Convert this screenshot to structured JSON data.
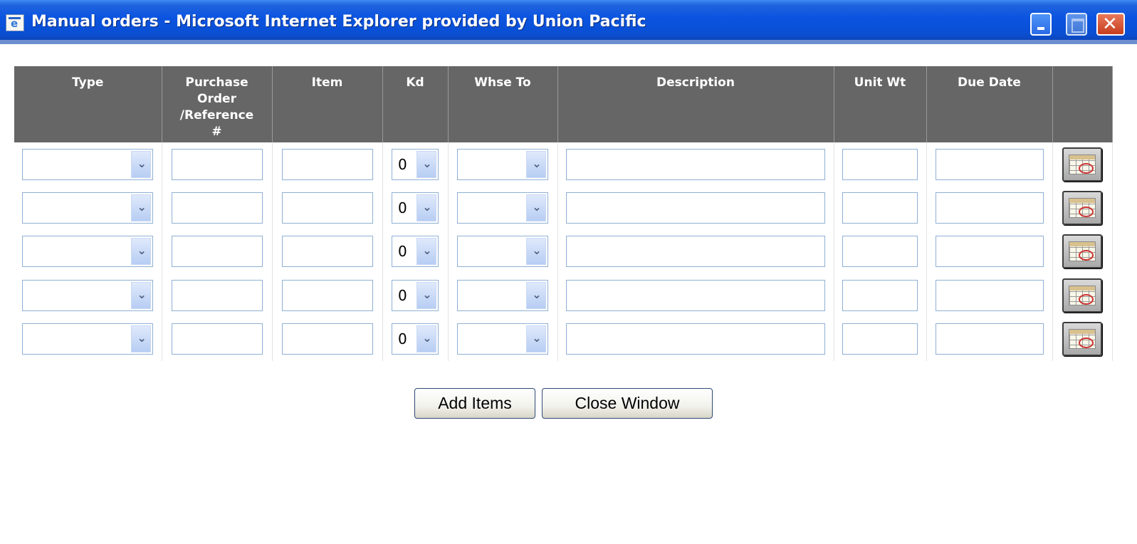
{
  "window": {
    "title": "Manual orders - Microsoft Internet Explorer provided by Union Pacific",
    "icon": "ie-page-icon",
    "controls": [
      "minimize-icon",
      "maximize-icon",
      "close-icon"
    ]
  },
  "table": {
    "columns": [
      {
        "key": "type",
        "label": "Type"
      },
      {
        "key": "po",
        "label": "Purchase\nOrder\n/Reference\n#"
      },
      {
        "key": "item",
        "label": "Item"
      },
      {
        "key": "kd",
        "label": "Kd"
      },
      {
        "key": "whse_to",
        "label": "Whse To"
      },
      {
        "key": "description",
        "label": "Description"
      },
      {
        "key": "unit_wt",
        "label": "Unit Wt"
      },
      {
        "key": "due_date",
        "label": "Due Date"
      },
      {
        "key": "calendar",
        "label": ""
      }
    ],
    "rows": [
      {
        "type": "",
        "po": "",
        "item": "",
        "kd": "0",
        "whse_to": "",
        "description": "",
        "unit_wt": "",
        "due_date": ""
      },
      {
        "type": "",
        "po": "",
        "item": "",
        "kd": "0",
        "whse_to": "",
        "description": "",
        "unit_wt": "",
        "due_date": ""
      },
      {
        "type": "",
        "po": "",
        "item": "",
        "kd": "0",
        "whse_to": "",
        "description": "",
        "unit_wt": "",
        "due_date": ""
      },
      {
        "type": "",
        "po": "",
        "item": "",
        "kd": "0",
        "whse_to": "",
        "description": "",
        "unit_wt": "",
        "due_date": ""
      },
      {
        "type": "",
        "po": "",
        "item": "",
        "kd": "0",
        "whse_to": "",
        "description": "",
        "unit_wt": "",
        "due_date": ""
      }
    ]
  },
  "actions": {
    "add_items": "Add Items",
    "close_window": "Close Window"
  },
  "colors": {
    "titlebar": "#0a4fd4",
    "header_bg": "#666666",
    "input_border": "#8fb0d4"
  }
}
